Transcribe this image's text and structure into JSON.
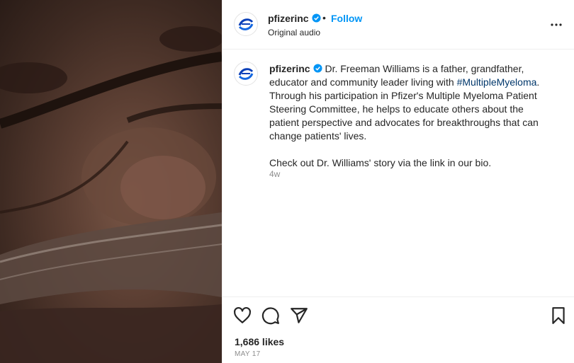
{
  "header": {
    "username": "pfizerinc",
    "separator": "•",
    "follow_label": "Follow",
    "audio_label": "Original audio"
  },
  "caption": {
    "username": "pfizerinc",
    "text_before_hashtag": "Dr. Freeman Williams is a father, grandfather, educator and community leader living with ",
    "hashtag": "#MultipleMyeloma",
    "text_after_hashtag": ". Through his participation in Pfizer's Multiple Myeloma Patient Steering Committee, he helps to educate others about the patient perspective and advocates for breakthroughs that can change patients' lives.",
    "second_paragraph": "Check out Dr. Williams' story via the link in our bio.",
    "age": "4w"
  },
  "footer": {
    "likes": "1,686 likes",
    "date": "MAY 17"
  },
  "icons": {
    "more": "more-options-icon",
    "like": "heart-icon",
    "comment": "comment-icon",
    "share": "share-icon",
    "save": "bookmark-icon",
    "verified": "verified-badge-icon",
    "logo": "pfizer-logo"
  },
  "colors": {
    "link_blue": "#0095f6",
    "hashtag": "#00376b",
    "verified": "#0095f6",
    "muted": "#8e8e8e"
  }
}
